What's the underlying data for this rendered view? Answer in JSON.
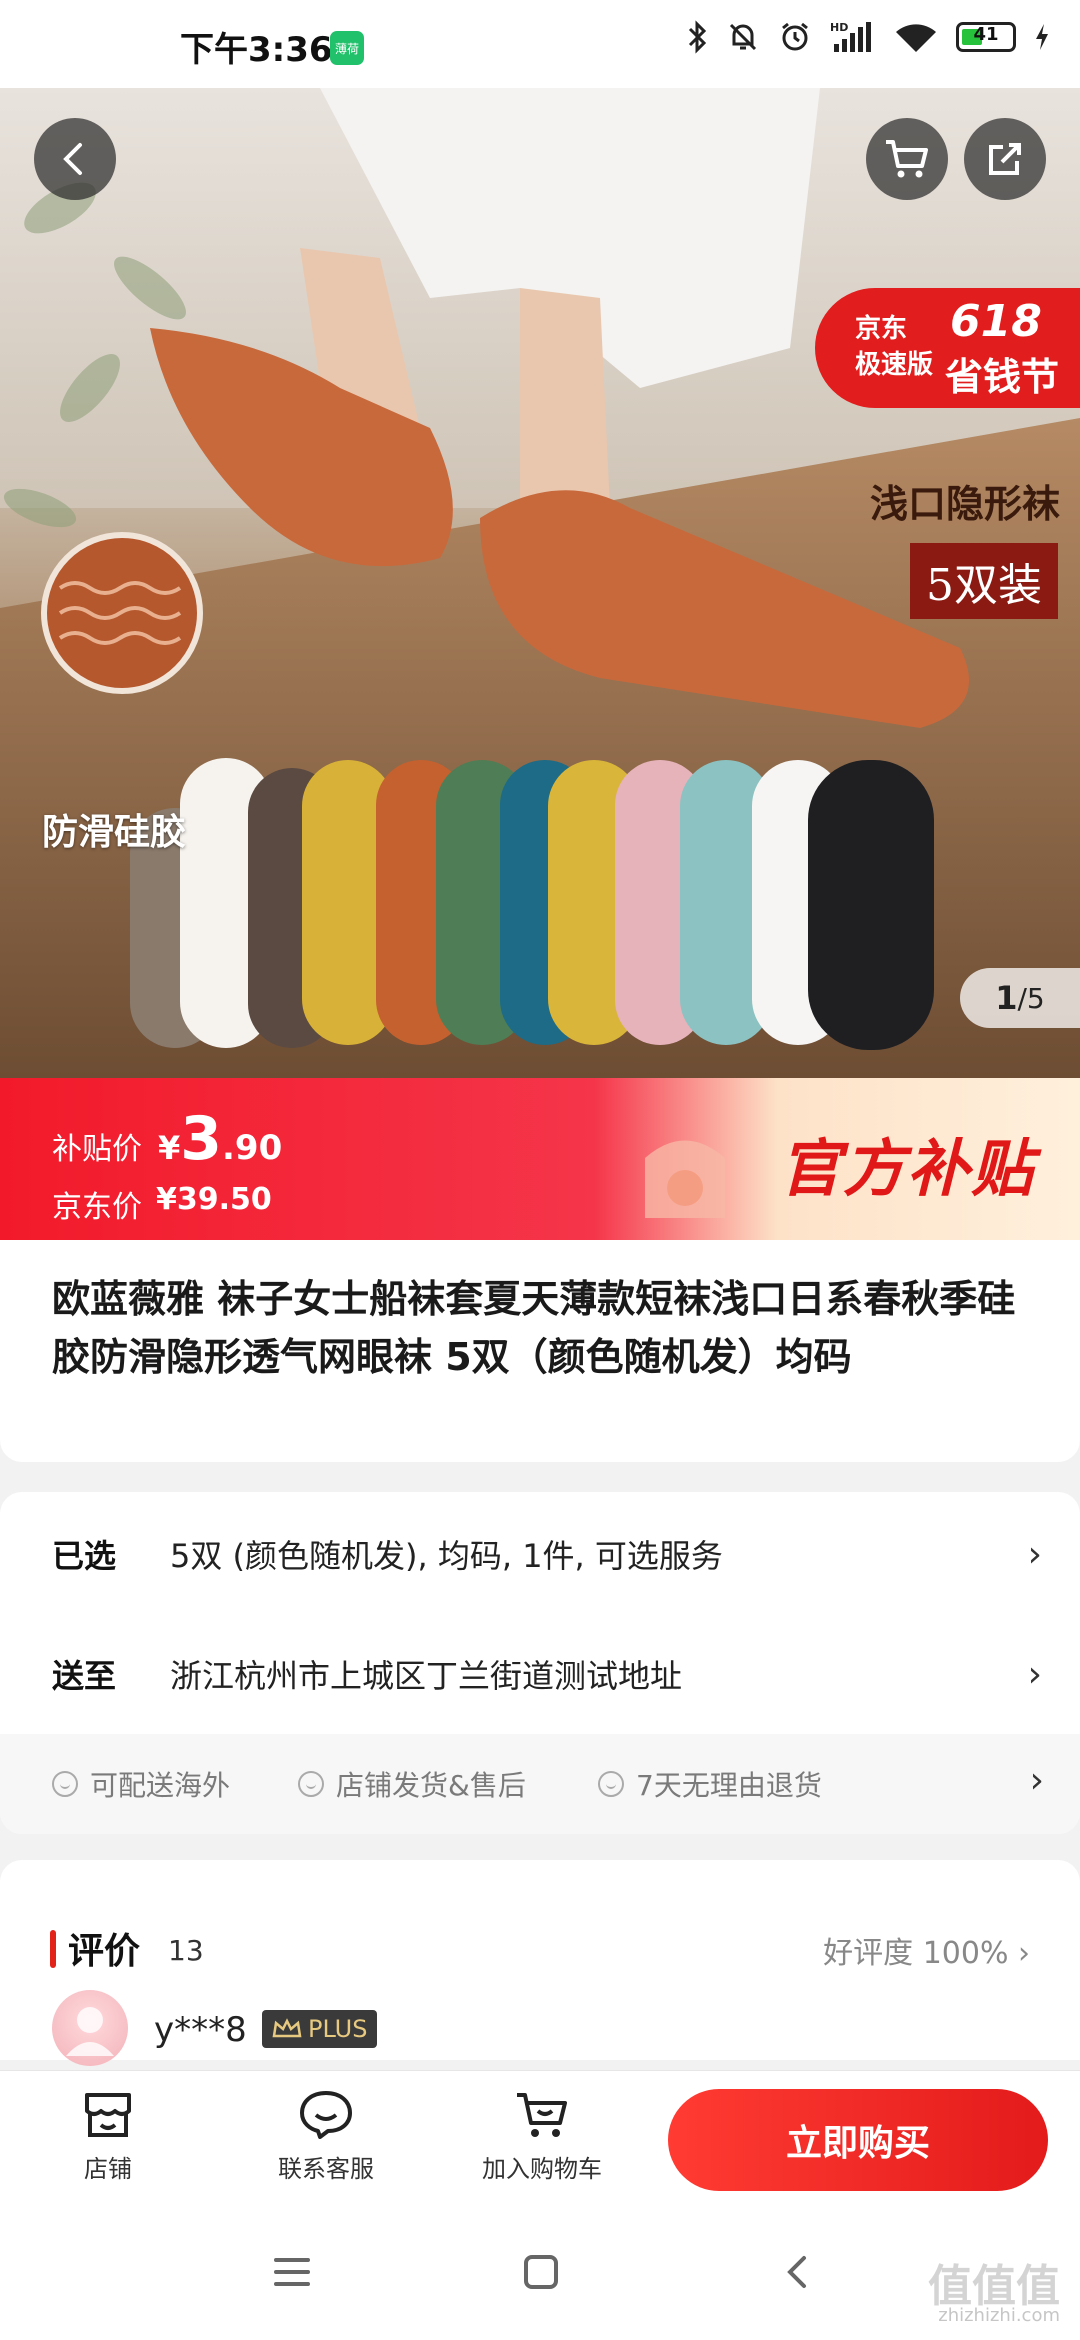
{
  "status_bar": {
    "time": "下午3:36",
    "app_badge": "薄荷",
    "battery_level": "41"
  },
  "hero": {
    "promo_line1": "京东",
    "promo_line2": "极速版",
    "promo_number": "618",
    "promo_title": "省钱节",
    "caption_1": "浅口隐形袜",
    "caption_2": "5双装",
    "caption_3": "防滑硅胶",
    "page_current": "1",
    "page_total": "/5"
  },
  "price": {
    "subsidy_label": "补贴价",
    "subsidy_currency": "¥",
    "subsidy_int": "3",
    "subsidy_dec": ".90",
    "jd_label": "京东价",
    "jd_price": "¥39.50",
    "banner_brand": "官方补贴"
  },
  "product": {
    "title": "欧蓝薇雅 袜子女士船袜套夏天薄款短袜浅口日系春秋季硅胶防滑隐形透气网眼袜  5双（颜色随机发）均码"
  },
  "info": {
    "selected_key": "已选",
    "selected_val": "5双 (颜色随机发), 均码, 1件, 可选服务",
    "ship_key": "送至",
    "ship_val": "浙江杭州市上城区丁兰街道测试地址",
    "arrow": "›",
    "services": [
      "可配送海外",
      "店铺发货&售后",
      "7天无理由退货"
    ]
  },
  "reviews": {
    "title": "评价",
    "count": "13",
    "rate": "好评度 100% ›",
    "user": "y***8",
    "plus": "PLUS"
  },
  "bottom_bar": {
    "store": "店铺",
    "service": "联系客服",
    "cart": "加入购物车",
    "buy": "立即购买"
  },
  "watermark": {
    "main": "值值值",
    "sub": "zhizhizhi.com"
  },
  "colors": {
    "accent": "#e2231a",
    "plus_gold": "#e7c980"
  }
}
